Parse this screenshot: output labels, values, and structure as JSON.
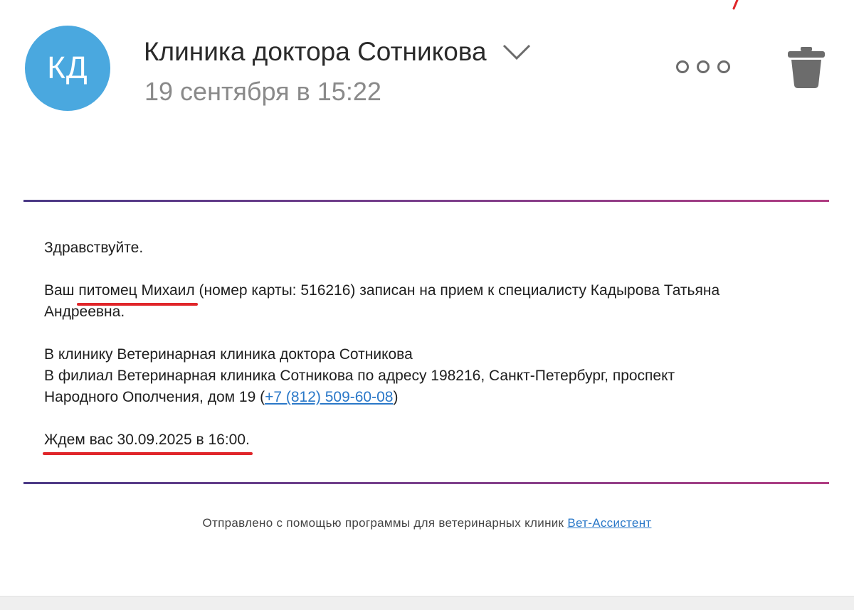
{
  "header": {
    "avatar_initials": "КД",
    "sender_name": "Клиника доктора Сотникова",
    "date": "19 сентября в 15:22",
    "more_icon": "more-horizontal-icon",
    "delete_icon": "trash-icon"
  },
  "message": {
    "greeting": "Здравствуйте.",
    "line1_prefix": "Ваш ",
    "pet_highlight": "питомец Михаил",
    "line1_rest": " (номер карты: 516216) записан на прием к специалисту Кадырова Татьяна",
    "line2": "Андреевна.",
    "clinic_line": "В клинику Ветеринарная клиника доктора Сотникова",
    "branch_line": "В филиал Ветеринарная клиника Сотникова по адресу 198216, Санкт-Петербург, проспект",
    "address_line_prefix": "Народного Ополчения, дом 19 (",
    "phone": "+7 (812) 509-60-08",
    "address_line_suffix": ")",
    "appointment": "Ждем вас 30.09.2025 в 16:00."
  },
  "footer": {
    "text": "Отправлено с помощью программы для ветеринарных клиник ",
    "link": "Вет-Ассистент"
  },
  "colors": {
    "avatar": "#4aa8df",
    "annotation_red": "#e0262a",
    "link": "#2a78c8"
  }
}
